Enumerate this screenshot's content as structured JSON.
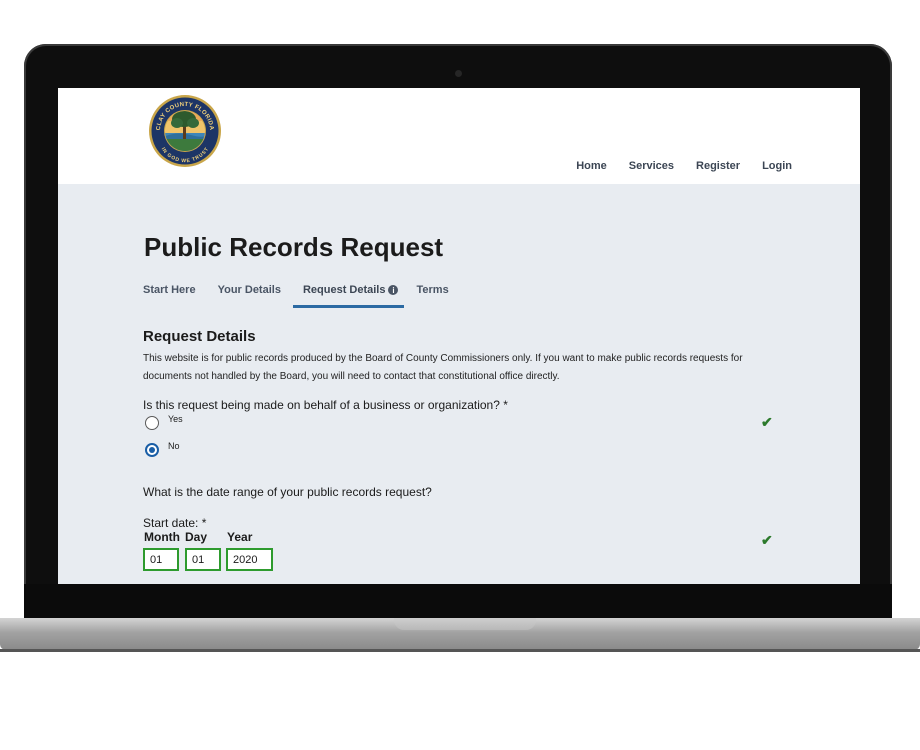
{
  "header": {
    "seal": {
      "top_text": "CLAY COUNTY FLORIDA",
      "bottom_text": "IN GOD WE TRUST"
    },
    "nav": [
      "Home",
      "Services",
      "Register",
      "Login"
    ]
  },
  "page": {
    "title": "Public Records Request",
    "tabs": [
      {
        "label": "Start Here"
      },
      {
        "label": "Your Details"
      },
      {
        "label": "Request Details",
        "icon": "info-icon",
        "icon_glyph": "i"
      },
      {
        "label": "Terms"
      }
    ],
    "section_title": "Request Details",
    "section_description": "This website is for public records produced by the Board of County Commissioners only. If you want to make public records requests for documents not handled by the Board, you will need to contact that constitutional office directly.",
    "question_business": "Is this request being made on behalf of a business or organization?  *",
    "options": {
      "yes": "Yes",
      "no": "No",
      "selected": "No"
    },
    "check_glyph": "✔",
    "question_date": "What is the date range of your public records request?",
    "start_date_label": "Start date:  *",
    "date_labels": {
      "month": "Month",
      "day": "Day",
      "year": "Year"
    },
    "start_date": {
      "month": "01",
      "day": "01",
      "year": "2020"
    }
  },
  "colors": {
    "accent": "#2b6aa3",
    "radio_selected": "#1a5ea6",
    "valid_green": "#2e9b2e",
    "page_background": "#e8ecf1"
  }
}
